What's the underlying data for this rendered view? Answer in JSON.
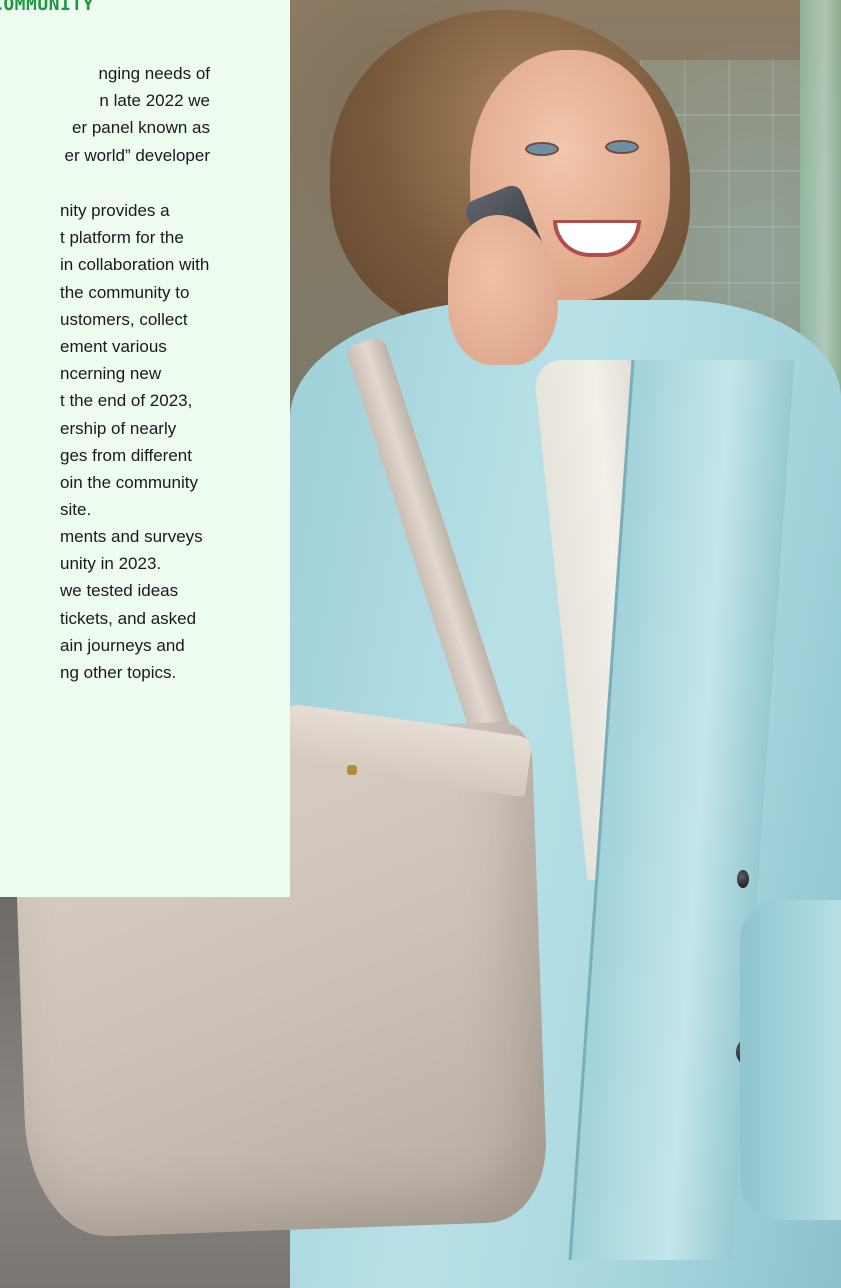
{
  "section": {
    "heading": "COMMUNITY"
  },
  "paragraphs": [
    {
      "lines": [
        "nging needs of",
        "n late 2022 we",
        "er panel known as",
        "er world” developer"
      ]
    },
    {
      "lines": [
        "nity provides a",
        "t platform for the",
        "in collaboration with",
        "the community to",
        "ustomers, collect",
        "ement various",
        "ncerning new",
        "t the end of 2023,",
        "ership of nearly",
        "ges from different",
        "oin the community",
        "site."
      ]
    },
    {
      "lines": [
        "ments and surveys",
        "unity in 2023.",
        "we tested ideas",
        "tickets, and asked",
        "ain journeys and",
        "ng other topics."
      ]
    }
  ],
  "photo": {
    "description_icon": "woman-on-phone-photo",
    "coat_color": "#b8e1e7",
    "panel_color": "#eefcef",
    "accent_color": "#1c9a43"
  }
}
